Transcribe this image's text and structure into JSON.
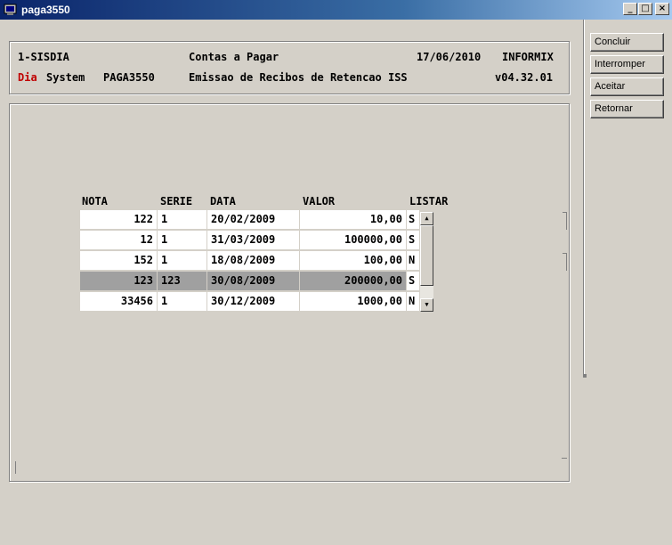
{
  "window": {
    "title": "paga3550",
    "min_label": "_",
    "max_label": "□",
    "close_label": "×"
  },
  "header": {
    "system": "1-SISDIA",
    "module": "Contas a Pagar",
    "date": "17/06/2010",
    "db": "INFORMIX",
    "brand_red": "Dia",
    "brand_rest": "System",
    "program": "PAGA3550",
    "description": "Emissao de Recibos de Retencao ISS",
    "version": "v04.32.01"
  },
  "table": {
    "columns": [
      "NOTA",
      "SERIE",
      "DATA",
      "VALOR",
      "LISTAR"
    ],
    "rows": [
      {
        "nota": "122",
        "serie": "1",
        "data": "20/02/2009",
        "valor": "10,00",
        "listar": "S"
      },
      {
        "nota": "12",
        "serie": "1",
        "data": "31/03/2009",
        "valor": "100000,00",
        "listar": "S"
      },
      {
        "nota": "152",
        "serie": "1",
        "data": "18/08/2009",
        "valor": "100,00",
        "listar": "N"
      },
      {
        "nota": "123",
        "serie": "123",
        "data": "30/08/2009",
        "valor": "200000,00",
        "listar": "S"
      },
      {
        "nota": "33456",
        "serie": "1",
        "data": "30/12/2009",
        "valor": "1000,00",
        "listar": "N"
      }
    ],
    "selected_row": 3
  },
  "actions": {
    "concluir": "Concluir",
    "interromper": "Interromper",
    "aceitar": "Aceitar",
    "retornar": "Retornar"
  },
  "colors": {
    "brand_red": "#c00000",
    "selected_row_bg": "#a0a0a0",
    "titlebar": "#0a246a"
  }
}
